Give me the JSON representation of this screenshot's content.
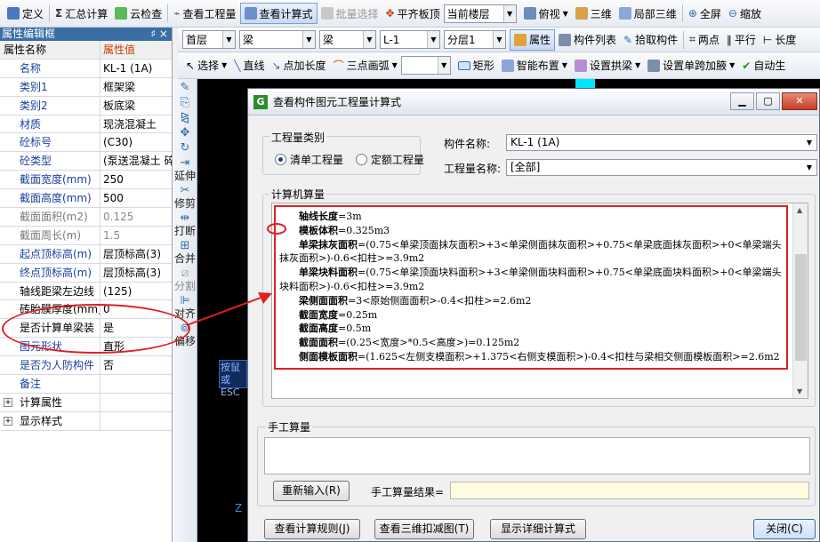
{
  "toolbar1": {
    "items": [
      "定义",
      "汇总计算",
      "云检查",
      "查看工程量",
      "查看计算式",
      "批量选择",
      "平齐板顶"
    ],
    "floor_combo": "当前楼层",
    "view_items": [
      "俯视",
      "三维",
      "局部三维",
      "全屏",
      "缩放"
    ]
  },
  "toolbar2": {
    "floor": "首层",
    "type1": "梁",
    "type2": "梁",
    "member": "L-1",
    "layer": "分层1",
    "items": [
      "属性",
      "构件列表",
      "拾取构件",
      "两点",
      "平行",
      "长度"
    ]
  },
  "toolbar3": {
    "items": [
      "选择",
      "直线",
      "点加长度",
      "三点画弧",
      "矩形",
      "智能布置",
      "设置拱梁",
      "设置单跨加腋",
      "自动生"
    ]
  },
  "panel": {
    "title": "属性编辑框",
    "pin": "♯ ×",
    "header": {
      "name": "属性名称",
      "value": "属性值"
    },
    "rows": [
      {
        "name": "名称",
        "value": "KL-1 (1A)"
      },
      {
        "name": "类别1",
        "value": "框架梁"
      },
      {
        "name": "类别2",
        "value": "板底梁"
      },
      {
        "name": "材质",
        "value": "现浇混凝土"
      },
      {
        "name": "砼标号",
        "value": "(C30)"
      },
      {
        "name": "砼类型",
        "value": "(泵送混凝土 碎"
      },
      {
        "name": "截面宽度(mm)",
        "value": "250"
      },
      {
        "name": "截面高度(mm)",
        "value": "500"
      },
      {
        "name": "截面面积(m2)",
        "value": "0.125"
      },
      {
        "name": "截面周长(m)",
        "value": "1.5"
      },
      {
        "name": "起点顶标高(m)",
        "value": "层顶标高(3)"
      },
      {
        "name": "终点顶标高(m)",
        "value": "层顶标高(3)"
      },
      {
        "name": "轴线距梁左边线",
        "value": "(125)"
      },
      {
        "name": "砖胎膜厚度(mm)",
        "value": "0"
      },
      {
        "name": "是否计算单梁装",
        "value": "是"
      },
      {
        "name": "图元形状",
        "value": "直形"
      },
      {
        "name": "是否为人防构件",
        "value": "否"
      },
      {
        "name": "备注",
        "value": ""
      }
    ],
    "groups": [
      "计算属性",
      "显示样式"
    ]
  },
  "vtool": [
    "延伸",
    "修剪",
    "打断",
    "合并",
    "分割",
    "对齐",
    "偏移"
  ],
  "canvas": {
    "hint": "按鼠或ESC",
    "z": "Z"
  },
  "dialog": {
    "title": "查看构件图元工程量计算式",
    "category_label": "工程量类别",
    "radio1": "清单工程量",
    "radio2": "定额工程量",
    "member_label": "构件名称:",
    "member_value": "KL-1 (1A)",
    "qty_label": "工程量名称:",
    "qty_value": "[全部]",
    "computer_label": "计算机算量",
    "lines": [
      {
        "k": "轴线长度",
        "v": "=3m"
      },
      {
        "k": "模板体积",
        "v": "=0.325m3"
      },
      {
        "k": "单梁抹灰面积",
        "v": "=(0.75<单梁顶面抹灰面积>+3<单梁侧面抹灰面积>+0.75<单梁底面抹灰面积>+0<单梁端头抹灰面积>)-0.6<扣柱>=3.9m2"
      },
      {
        "k": "单梁块料面积",
        "v": "=(0.75<单梁顶面块料面积>+3<单梁侧面块料面积>+0.75<单梁底面块料面积>+0<单梁端头块料面积>)-0.6<扣柱>=3.9m2"
      },
      {
        "k": "梁侧面面积",
        "v": "=3<原始侧面面积>-0.4<扣柱>=2.6m2"
      },
      {
        "k": "截面宽度",
        "v": "=0.25m"
      },
      {
        "k": "截面高度",
        "v": "=0.5m"
      },
      {
        "k": "截面面积",
        "v": "=(0.25<宽度>*0.5<高度>)=0.125m2"
      },
      {
        "k": "侧面模板面积",
        "v": "=(1.625<左侧支模面积>+1.375<右侧支模面积>)-0.4<扣柱与梁相交侧面模板面积>=2.6m2"
      }
    ],
    "manual_label": "手工算量",
    "reinput": "重新输入(R)",
    "result_label": "手工算量结果=",
    "btn_rules": "查看计算规则(J)",
    "btn_3d": "查看三维扣减图(T)",
    "btn_detail": "显示详细计算式",
    "btn_close": "关闭(C)"
  }
}
